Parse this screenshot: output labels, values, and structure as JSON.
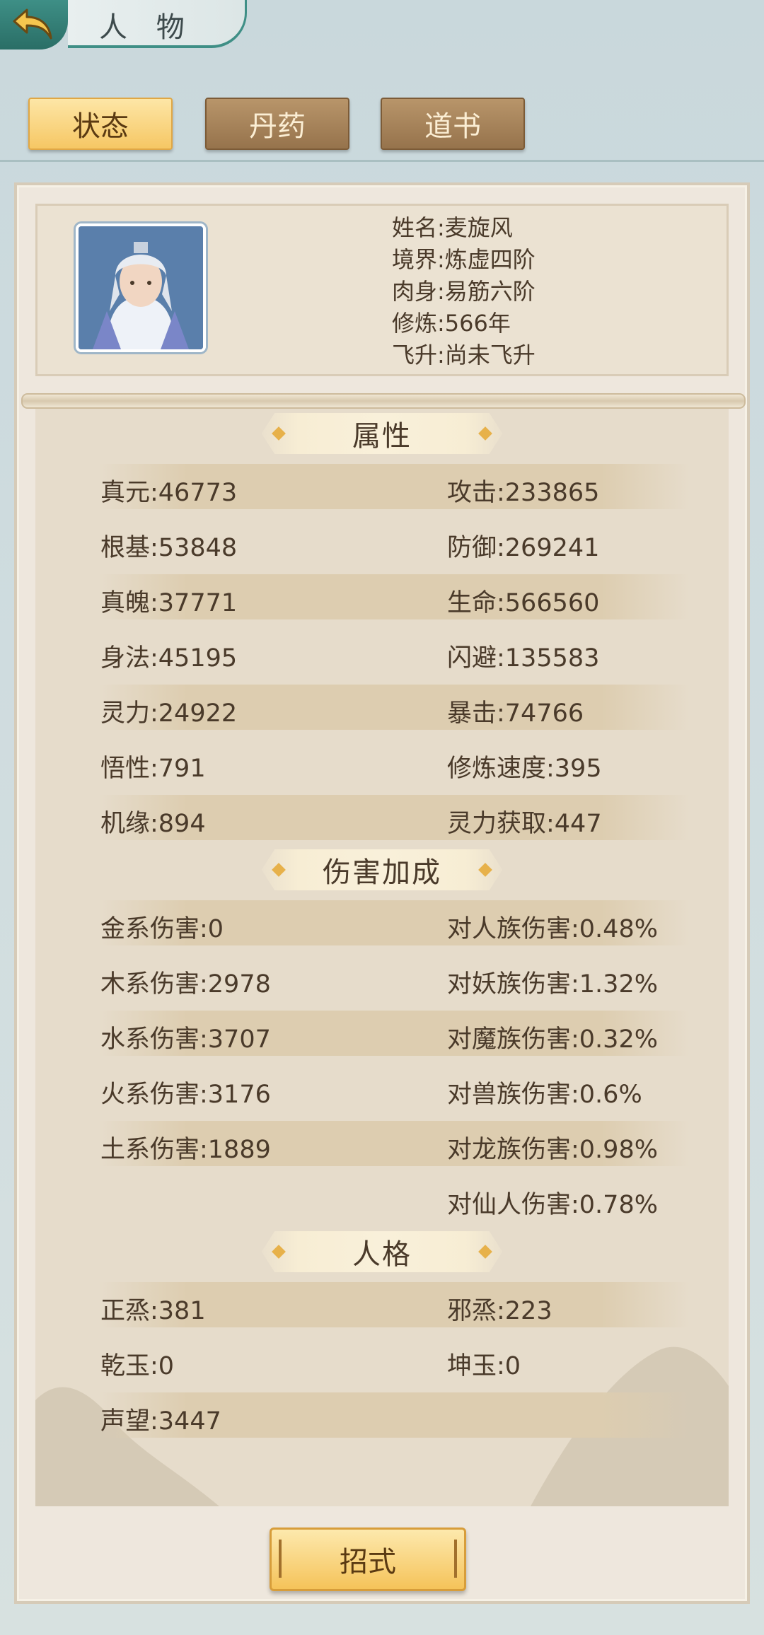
{
  "header": {
    "title": "人 物"
  },
  "tabs": [
    {
      "label": "状态",
      "active": true
    },
    {
      "label": "丹药",
      "active": false
    },
    {
      "label": "道书",
      "active": false
    }
  ],
  "profile": {
    "name": "姓名:麦旋风",
    "realm": "境界:炼虚四阶",
    "body": "肉身:易筋六阶",
    "cultivation": "修炼:566年",
    "ascension": "飞升:尚未飞升"
  },
  "sections": {
    "attributes": "属性",
    "damage": "伤害加成",
    "personality": "人格"
  },
  "attributes": [
    [
      "真元:46773",
      "攻击:233865"
    ],
    [
      "根基:53848",
      "防御:269241"
    ],
    [
      "真魄:37771",
      "生命:566560"
    ],
    [
      "身法:45195",
      "闪避:135583"
    ],
    [
      "灵力:24922",
      "暴击:74766"
    ],
    [
      "悟性:791",
      "修炼速度:395"
    ],
    [
      "机缘:894",
      "灵力获取:447"
    ]
  ],
  "damage": [
    [
      "金系伤害:0",
      "对人族伤害:0.48%"
    ],
    [
      "木系伤害:2978",
      "对妖族伤害:1.32%"
    ],
    [
      "水系伤害:3707",
      "对魔族伤害:0.32%"
    ],
    [
      "火系伤害:3176",
      "对兽族伤害:0.6%"
    ],
    [
      "土系伤害:1889",
      "对龙族伤害:0.98%"
    ],
    [
      "",
      "对仙人伤害:0.78%"
    ]
  ],
  "personality": [
    [
      "正烝:381",
      "邪烝:223"
    ],
    [
      "乾玉:0",
      "坤玉:0"
    ],
    [
      "声望:3447",
      ""
    ]
  ],
  "bottom_button": "招式",
  "colors": {
    "accent": "#3f8f86",
    "tab_active": "#f6c764",
    "tab_inactive": "#96734c"
  }
}
